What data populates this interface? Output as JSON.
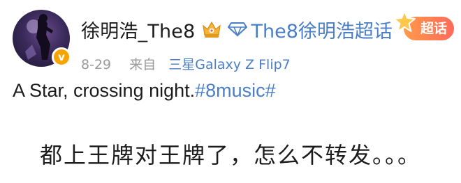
{
  "post": {
    "username": "徐明浩_The8",
    "supertopic_link": "The8徐明浩超话",
    "chaohua_badge": "超话",
    "verified_badge": "v",
    "date": "8-29",
    "from_label": "来自",
    "device": "三星Galaxy Z Flip7",
    "text": "A Star, crossing night.",
    "hashtag": "#8music#"
  },
  "caption": "都上王牌对王牌了，怎么不转发。。。",
  "colors": {
    "link": "#4a7fc8",
    "verified": "#f7a400",
    "chaohua_start": "#ff9a4a",
    "chaohua_end": "#ff6a5a"
  },
  "icons": {
    "crown": "crown-icon",
    "diamond": "diamond-icon",
    "star": "star-icon"
  }
}
